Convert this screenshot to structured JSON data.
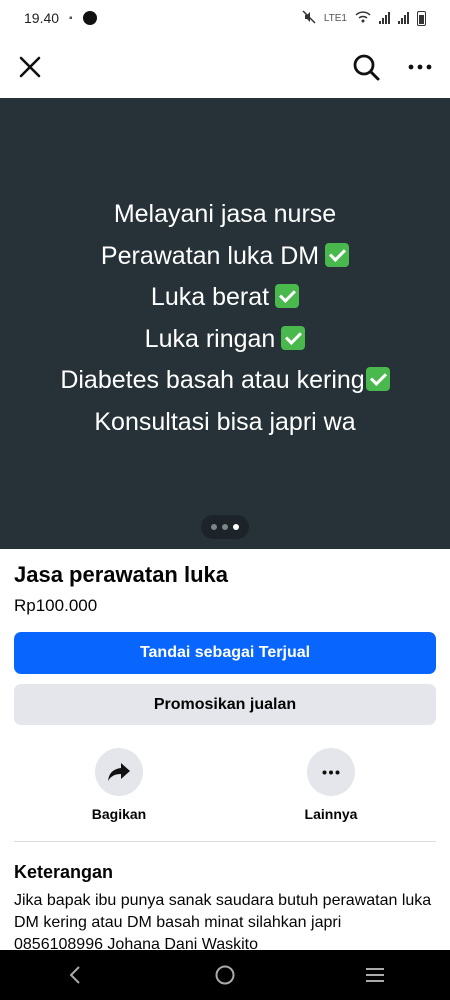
{
  "status": {
    "time": "19.40",
    "net_label": "LTE1"
  },
  "hero": {
    "lines": [
      "Melayani jasa nurse",
      "Perawatan luka DM",
      "Luka berat",
      "Luka ringan",
      "Diabetes basah atau kering",
      "Konsultasi bisa japri wa"
    ],
    "background": "#263238",
    "carousel": {
      "count": 3,
      "active_index": 2
    }
  },
  "listing": {
    "title": "Jasa perawatan luka",
    "price": "Rp100.000"
  },
  "buttons": {
    "mark_sold": "Tandai sebagai Terjual",
    "promote": "Promosikan jualan"
  },
  "actions": {
    "share": "Bagikan",
    "more": "Lainnya"
  },
  "description": {
    "heading": "Keterangan",
    "text": "Jika bapak ibu punya sanak saudara butuh perawatan luka DM kering atau DM basah minat silahkan japri 0856108996 Johana Dani Waskito"
  },
  "colors": {
    "primary": "#0866ff",
    "secondary_bg": "#e4e6eb",
    "check": "#49b84d"
  },
  "icons": {
    "close": "close-icon",
    "search": "search-icon",
    "more": "more-horizontal-icon",
    "share": "share-arrow-icon",
    "back": "back-icon",
    "home": "home-icon",
    "recents": "recents-icon"
  }
}
